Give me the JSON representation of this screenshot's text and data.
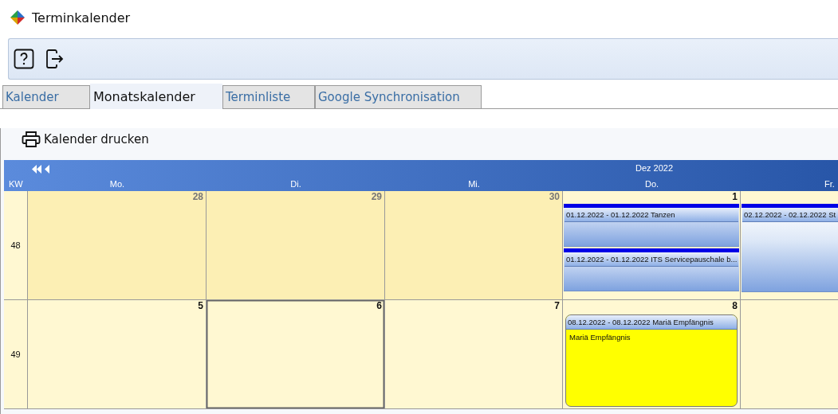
{
  "window": {
    "title": "Terminkalender"
  },
  "tabs": [
    {
      "label": "Kalender",
      "selected": false
    },
    {
      "label": "Monatskalender",
      "selected": true
    },
    {
      "label": "Terminliste",
      "selected": false
    },
    {
      "label": "Google Synchronisation",
      "selected": false
    }
  ],
  "print_button": {
    "label": "Kalender drucken"
  },
  "calendar": {
    "month": "Dez 2022",
    "week_label": "KW",
    "weekdays": [
      "Mo.",
      "Di.",
      "Mi.",
      "Do.",
      "Fr."
    ],
    "weeks": [
      {
        "week": "48",
        "days": [
          {
            "day": "28",
            "in_month": false,
            "selected": false
          },
          {
            "day": "29",
            "in_month": false,
            "selected": false
          },
          {
            "day": "30",
            "in_month": false,
            "selected": false
          },
          {
            "day": "1",
            "in_month": true,
            "selected": false,
            "events": [
              {
                "kind": "bar",
                "title": "01.12.2022 - 01.12.2022 Tanzen"
              },
              {
                "kind": "bar",
                "title": "01.12.2022 - 01.12.2022 ITS Servicepauschale b..."
              }
            ]
          },
          {
            "in_month": true,
            "selected": false,
            "events": [
              {
                "kind": "tall",
                "title": "02.12.2022 - 02.12.2022 St"
              }
            ]
          }
        ]
      },
      {
        "week": "49",
        "days": [
          {
            "day": "5",
            "in_month": true,
            "selected": false
          },
          {
            "day": "6",
            "in_month": true,
            "selected": true
          },
          {
            "day": "7",
            "in_month": true,
            "selected": false
          },
          {
            "day": "8",
            "in_month": true,
            "selected": false,
            "events": [
              {
                "kind": "holiday",
                "title": "08.12.2022 - 08.12.2022 Mariä Empfängnis",
                "note": "Mariä Empfängnis"
              }
            ]
          },
          {
            "in_month": true,
            "selected": false
          }
        ]
      }
    ]
  }
}
